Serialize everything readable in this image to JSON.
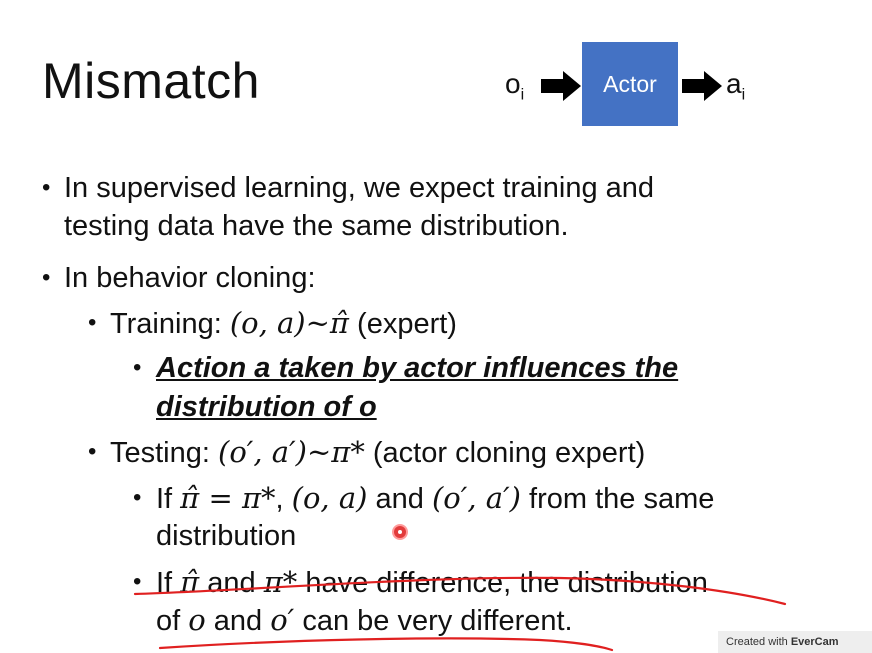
{
  "slide": {
    "title": "Mismatch",
    "diagram": {
      "input_label": "o",
      "input_sub": "i",
      "box_label": "Actor",
      "output_label": "a",
      "output_sub": "i",
      "box_color": "#4472c4"
    },
    "bullets": {
      "b1_line1": "In supervised learning, we expect training and",
      "b1_line2": "testing data have the same distribution.",
      "b2": "In behavior cloning:",
      "training_prefix": "Training: ",
      "training_math": "(o, a)~π̂",
      "training_suffix": " (expert)",
      "emph_line1": "Action a taken by actor influences the",
      "emph_line2": "distribution of o",
      "testing_prefix": "Testing: ",
      "testing_math": "(o′, a′)~π*",
      "testing_suffix": " (actor cloning expert)",
      "if1_prefix": "If ",
      "if1_math1": "π̂ = π*",
      "if1_comma": ", ",
      "if1_math2": "(o, a)",
      "if1_and": " and ",
      "if1_math3": "(o′, a′)",
      "if1_suffix": " from the same",
      "if1_line2": "distribution",
      "if2_prefix": "If ",
      "if2_math1": "π̂",
      "if2_and": " and ",
      "if2_math2": "π*",
      "if2_suffix": " have difference, the distribution",
      "if2_l2_of": "of ",
      "if2_l2_math1": "o",
      "if2_l2_and": " and ",
      "if2_l2_math2": "o′",
      "if2_l2_suffix": " can be very different."
    },
    "annotation_color": "#e02020",
    "watermark_prefix": "Created with ",
    "watermark_brand": "EverCam"
  }
}
